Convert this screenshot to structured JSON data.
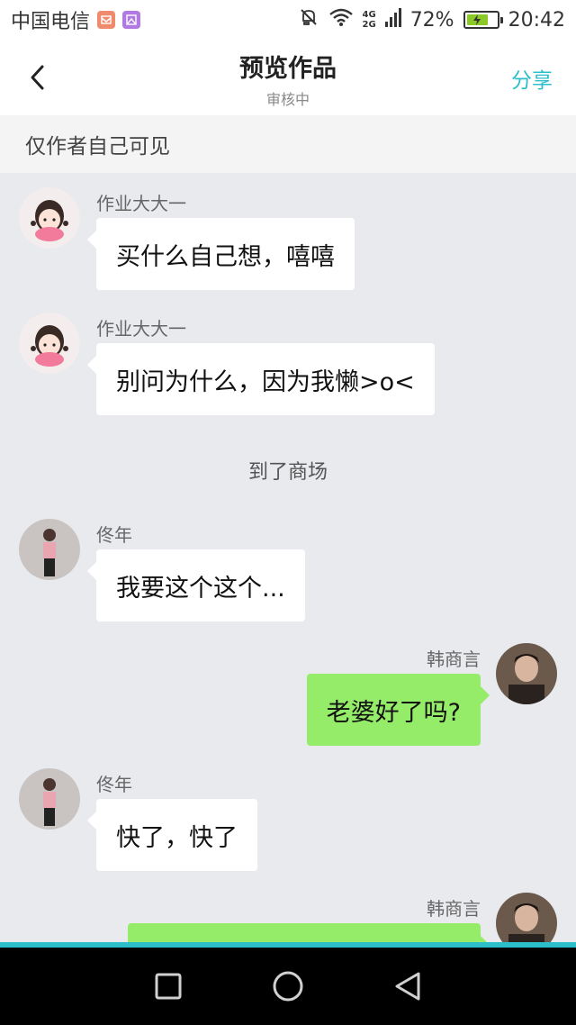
{
  "status_bar": {
    "carrier": "中国电信",
    "network_top": "4G",
    "network_bottom": "2G",
    "battery_percent": "72%",
    "time": "20:42",
    "battery_level": 0.72,
    "icons": [
      "mail-notification-icon",
      "gallery-notification-icon",
      "silent-icon",
      "wifi-icon",
      "signal-icon",
      "battery-icon"
    ]
  },
  "nav_bar": {
    "title": "预览作品",
    "subtitle": "审核中",
    "share_label": "分享"
  },
  "notice": {
    "text": "仅作者自己可见"
  },
  "messages": [
    {
      "side": "left",
      "sender": "作业大大一",
      "text": "买什么自己想，嘻嘻",
      "avatar": "cartoon-girl"
    },
    {
      "side": "left",
      "sender": "作业大大一",
      "text": "别问为什么，因为我懒>o<",
      "avatar": "cartoon-girl"
    },
    {
      "side": "left",
      "sender": "佟年",
      "text": "我要这个这个...",
      "avatar": "girl-photo"
    },
    {
      "side": "right",
      "sender": "韩商言",
      "text": "老婆好了吗?",
      "avatar": "man-photo"
    },
    {
      "side": "left",
      "sender": "佟年",
      "text": "快了，快了",
      "avatar": "girl-photo"
    },
    {
      "side": "right",
      "sender": "韩商言",
      "text": "",
      "avatar": "man-photo"
    }
  ],
  "narration": {
    "text": "到了商场"
  },
  "colors": {
    "accent": "#2cbfc9",
    "bubble_self": "#95ec69",
    "bubble_other": "#ffffff",
    "chat_bg": "#e9eaee"
  }
}
